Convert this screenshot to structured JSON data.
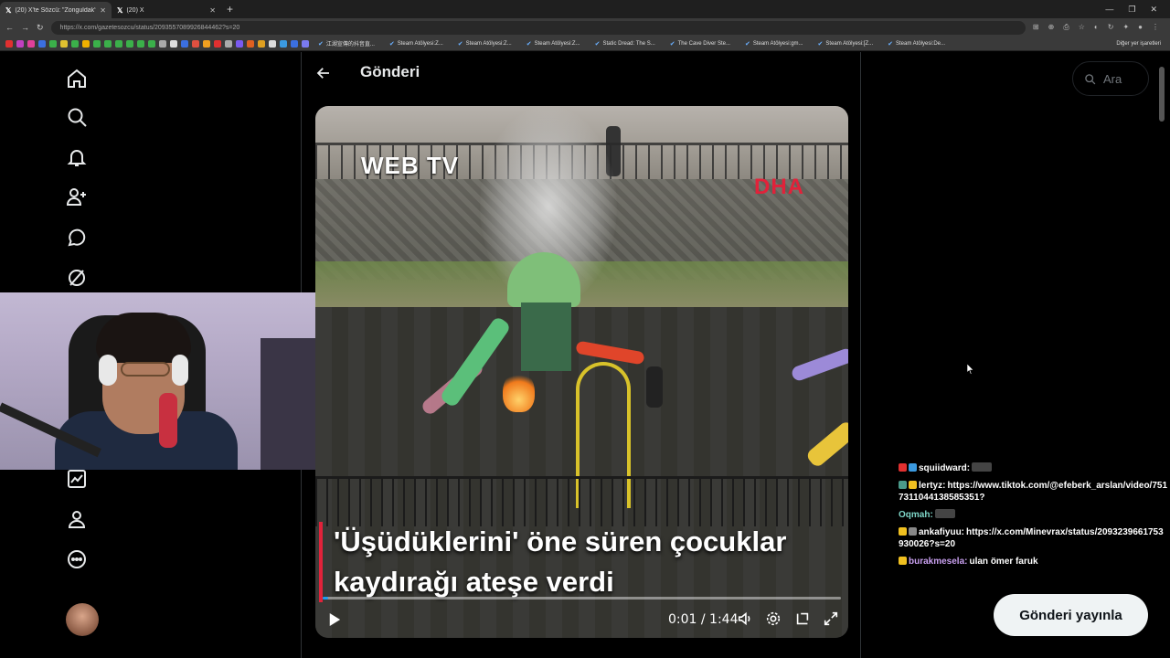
{
  "browser": {
    "tabs": [
      {
        "title": "(20) X'te Sözcü: \"Zonguldak'ta üşü",
        "active": true
      },
      {
        "title": "(20) X",
        "active": false
      }
    ],
    "url": "https://x.com/gazetesozcu/status/2093557089926844462?s=20",
    "bookmarks": [
      "江湖宣傳的抖音直...",
      "Steam Atölyesi:Z...",
      "Steam Atölyesi:Z...",
      "Steam Atölyesi:Z...",
      "Static Dread: The S...",
      "The Cave Diver Ste...",
      "Steam Atölyesi:gm...",
      "Steam Atölyesi:[Z...",
      "Steam Atölyesi:De..."
    ],
    "other_bookmarks": "Diğer yer işaretleri",
    "bookmark_icon_colors": [
      "#e03030",
      "#c040c0",
      "#e0409a",
      "#3b6fe0",
      "#3bb04a",
      "#e0c030",
      "#3bb04a",
      "#f0b000",
      "#3bb04a",
      "#3bb04a",
      "#3bb04a",
      "#3bb04a",
      "#3bb04a",
      "#3bb04a",
      "#aaaaaa",
      "#dddddd",
      "#3b6fe0",
      "#e05040",
      "#f0a020",
      "#e03030",
      "#aaaaaa",
      "#7a5af0",
      "#e06020",
      "#e0a020",
      "#dddddd",
      "#3b9ae0",
      "#3b6fe0",
      "#7a7af0"
    ]
  },
  "page": {
    "title": "Gönderi",
    "search_placeholder": "Ara"
  },
  "nav_icons": [
    "home-icon",
    "explore-icon",
    "notifications-icon",
    "follow-icon",
    "messages-icon",
    "grok-icon",
    "premium-icon",
    "profile-icon",
    "more-icon"
  ],
  "video": {
    "watermark_left": "WEB TV",
    "watermark_right": "DHA",
    "caption_line1": "'Üşüdüklerini' öne süren çocuklar",
    "caption_line2": "kaydırağı ateşe verdi",
    "time": "0:01 / 1:44",
    "progress": 0.01
  },
  "chat": [
    {
      "badges": [
        "#e03030",
        "#3b9ae0"
      ],
      "user": "squiidward:",
      "user_color": "#ffffff",
      "text": ""
    },
    {
      "badges": [
        "#4a9a8a",
        "#f0c020"
      ],
      "user": "lertyz:",
      "user_color": "#ffffff",
      "text": "https://www.tiktok.com/@efeberk_arslan/video/7517311044138585351?"
    },
    {
      "badges": [],
      "user": "Oqmah:",
      "user_color": "#7ed6c8",
      "text": ""
    },
    {
      "badges": [
        "#f0c020",
        "#888888"
      ],
      "user": "ankafiyuu:",
      "user_color": "#ffffff",
      "text": "https://x.com/Minevrax/status/2093239661753930026?s=20"
    },
    {
      "badges": [
        "#f0c020"
      ],
      "user": "burakmesela:",
      "user_color": "#c9a0f0",
      "text": "ulan ömer faruk"
    }
  ],
  "post_button": "Gönderi yayınla"
}
